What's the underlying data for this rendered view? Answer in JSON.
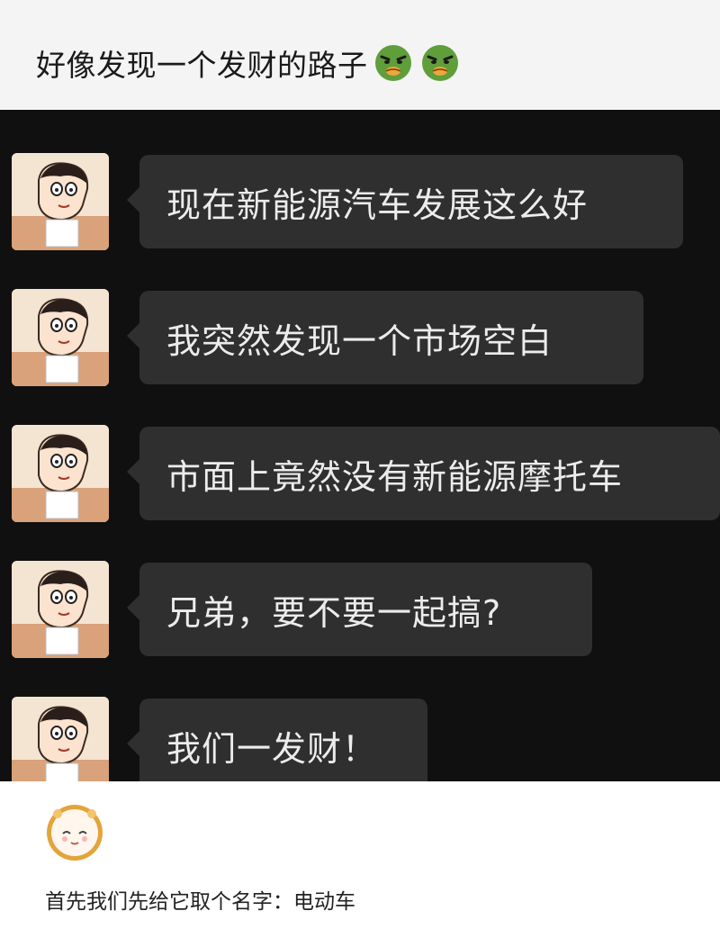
{
  "post": {
    "title": "好像发现一个发财的路子",
    "title_emojis": [
      "nauseated-face-icon",
      "nauseated-face-icon"
    ]
  },
  "chat": {
    "messages": [
      {
        "text": "现在新能源汽车发展这么好"
      },
      {
        "text": "我突然发现一个市场空白"
      },
      {
        "text": "市面上竟然没有新能源摩托车"
      },
      {
        "text": "兄弟，要不要一起搞?"
      },
      {
        "text": "我们一发财！"
      }
    ]
  },
  "comment": {
    "text": "首先我们先给它取个名字：电动车"
  },
  "colors": {
    "chat_background": "#101010",
    "bubble": "#2f2f2f",
    "bubble_text": "#ececec",
    "header_background": "#f4f4f4"
  }
}
